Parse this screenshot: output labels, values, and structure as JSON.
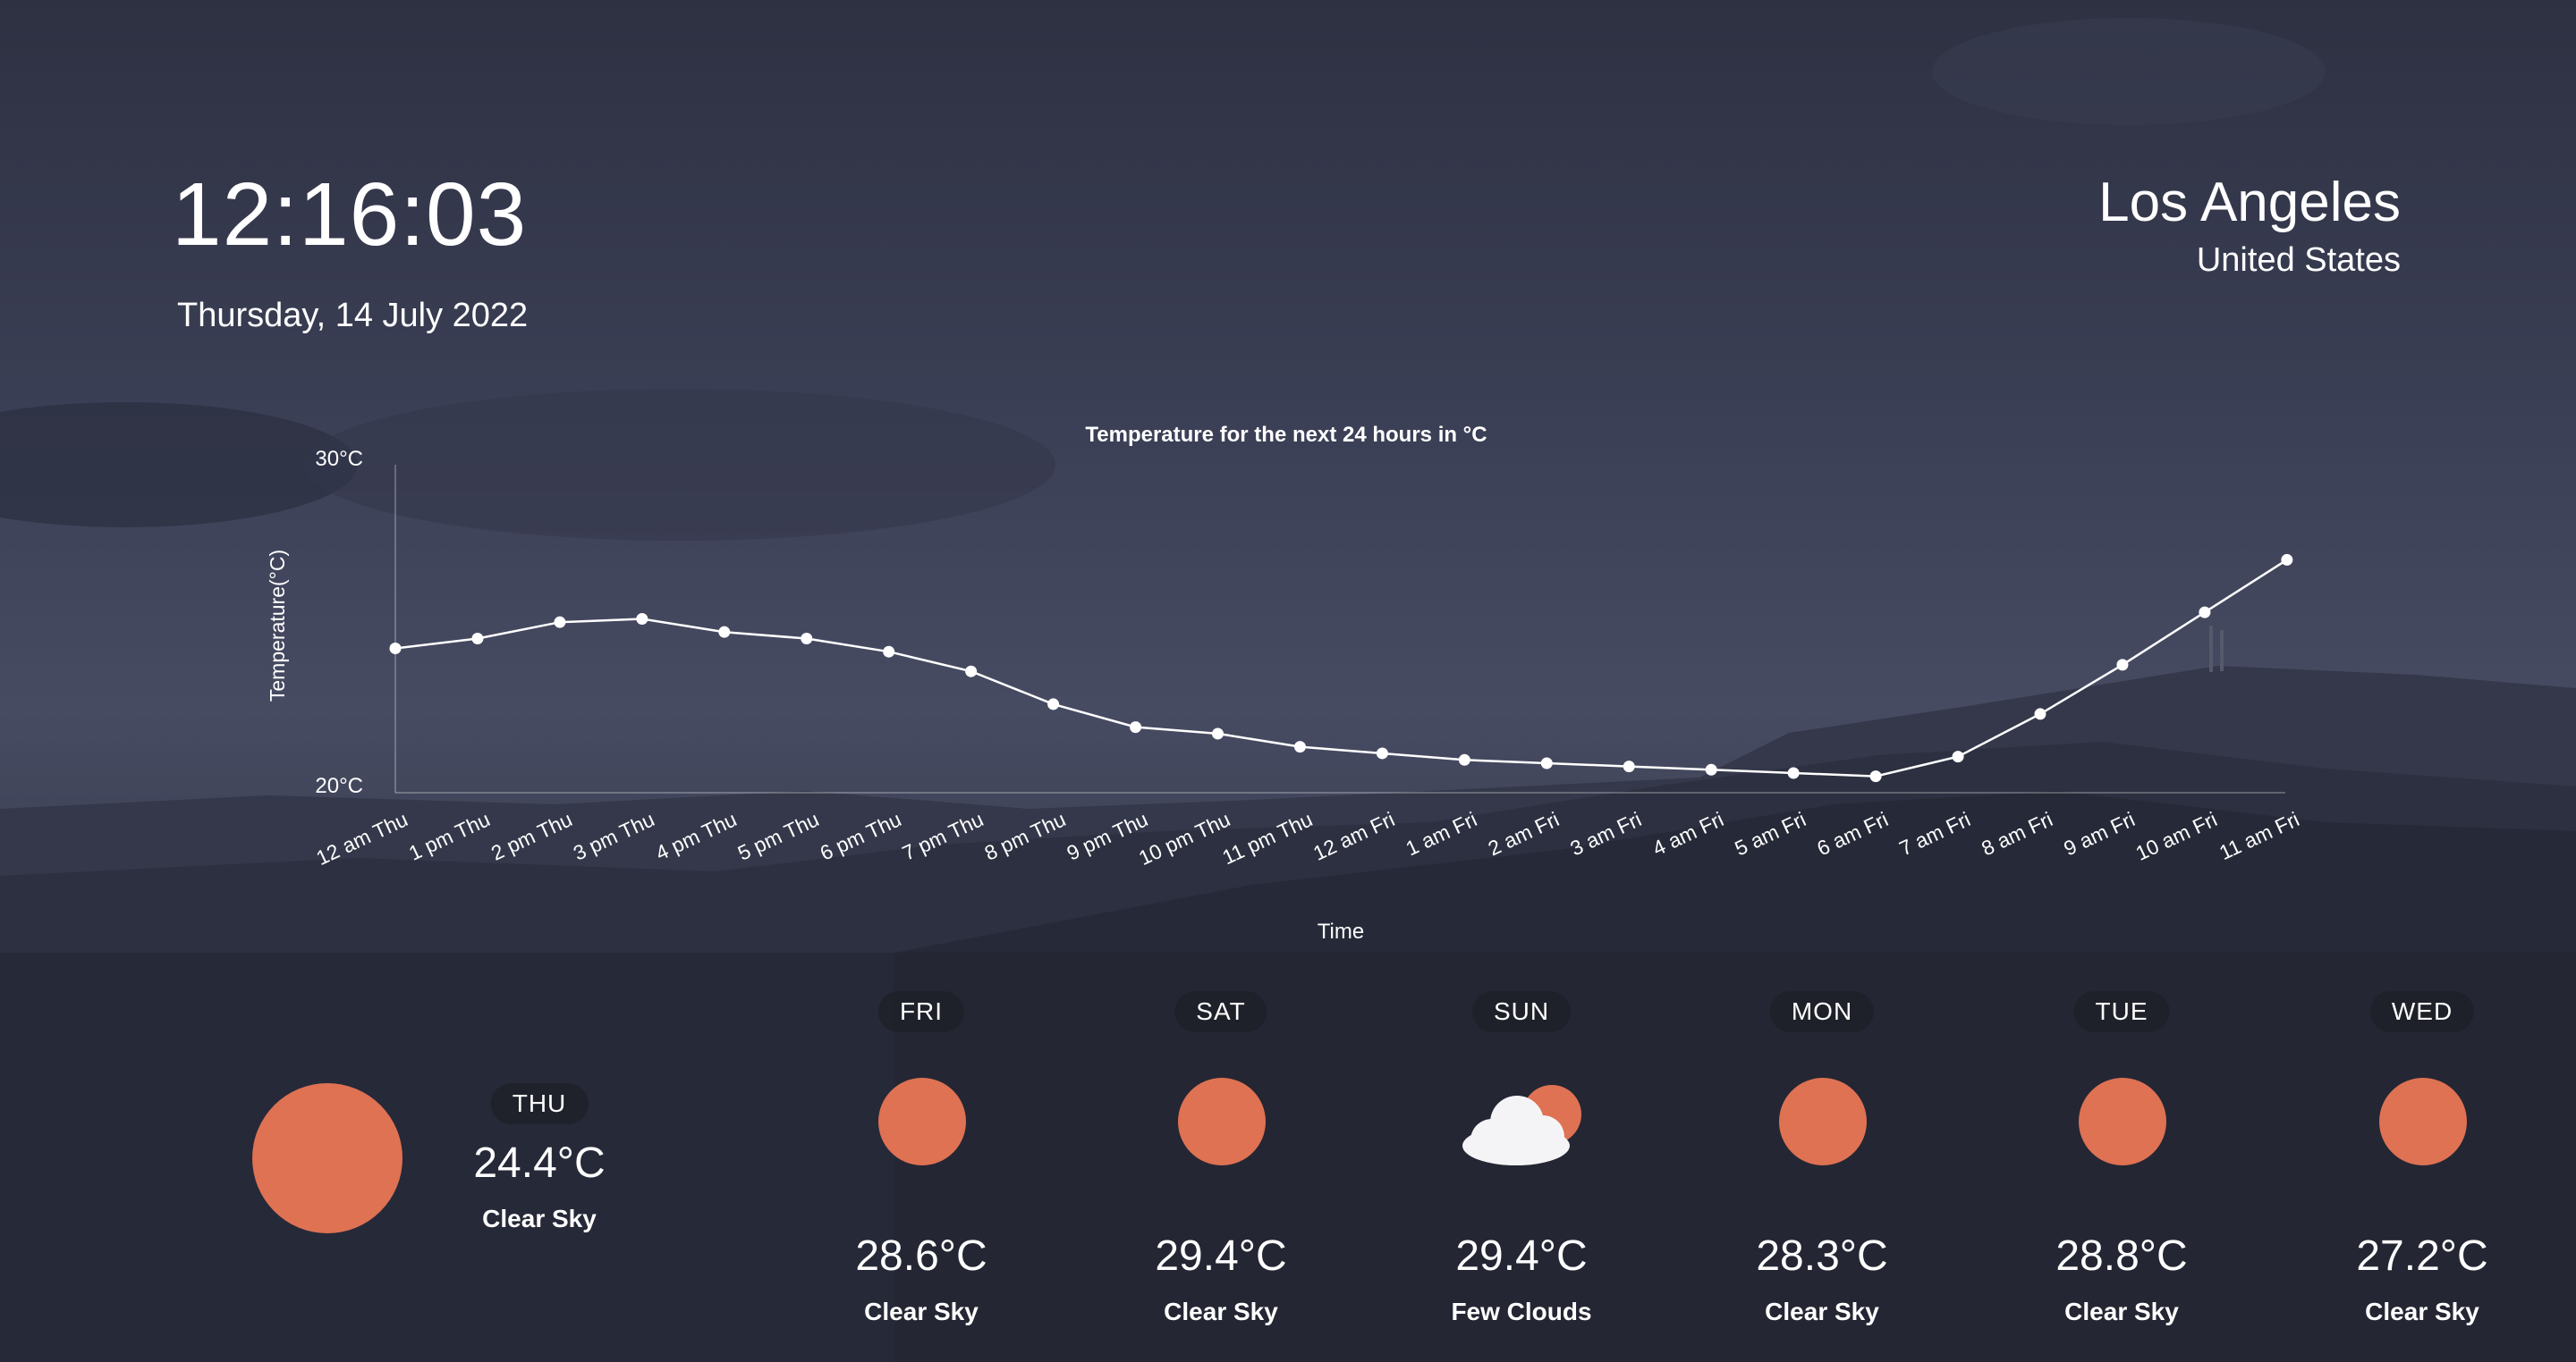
{
  "clock": {
    "time": "12:16:03",
    "date": "Thursday, 14 July 2022"
  },
  "location": {
    "city": "Los Angeles",
    "country": "United States"
  },
  "colors": {
    "sun": "#de7253",
    "line": "#ffffff"
  },
  "chart_data": {
    "type": "line",
    "title": "Temperature for the next 24 hours in °C",
    "xlabel": "Time",
    "ylabel": "Temperature(°C)",
    "ylim": [
      20,
      30
    ],
    "ytick_labels": [
      "30°C",
      "20°C"
    ],
    "categories": [
      "12 am Thu",
      "1 pm Thu",
      "2 pm Thu",
      "3 pm Thu",
      "4 pm Thu",
      "5 pm Thu",
      "6 pm Thu",
      "7 pm Thu",
      "8 pm Thu",
      "9 pm Thu",
      "10 pm Thu",
      "11 pm Thu",
      "12 am Fri",
      "1 am Fri",
      "2 am Fri",
      "3 am Fri",
      "4 am Fri",
      "5 am Fri",
      "6 am Fri",
      "7 am Fri",
      "8 am Fri",
      "9 am Fri",
      "10 am Fri",
      "11 am Fri"
    ],
    "series": [
      {
        "values": [
          24.4,
          24.7,
          25.2,
          25.3,
          24.9,
          24.7,
          24.3,
          23.7,
          22.7,
          22.0,
          21.8,
          21.4,
          21.2,
          21.0,
          20.9,
          20.8,
          20.7,
          20.6,
          20.5,
          21.1,
          22.4,
          23.9,
          25.5,
          27.1
        ]
      }
    ],
    "grid": false
  },
  "current": {
    "day": "THU",
    "temp": "24.4°C",
    "desc": "Clear Sky",
    "icon": "sun-icon"
  },
  "forecast": [
    {
      "day": "FRI",
      "temp": "28.6°C",
      "desc": "Clear Sky",
      "icon": "sun-icon"
    },
    {
      "day": "SAT",
      "temp": "29.4°C",
      "desc": "Clear Sky",
      "icon": "sun-icon"
    },
    {
      "day": "SUN",
      "temp": "29.4°C",
      "desc": "Few Clouds",
      "icon": "sun-behind-cloud-icon"
    },
    {
      "day": "MON",
      "temp": "28.3°C",
      "desc": "Clear Sky",
      "icon": "sun-icon"
    },
    {
      "day": "TUE",
      "temp": "28.8°C",
      "desc": "Clear Sky",
      "icon": "sun-icon"
    },
    {
      "day": "WED",
      "temp": "27.2°C",
      "desc": "Clear Sky",
      "icon": "sun-icon"
    }
  ]
}
